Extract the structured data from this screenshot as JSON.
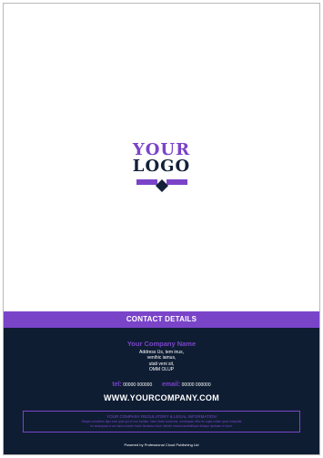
{
  "logo": {
    "line1": "YOUR",
    "line2": "LOGO",
    "mark_icon": "chevron-diamond-icon",
    "colors": {
      "accent": "#7a44c9",
      "dark": "#13203a"
    }
  },
  "contact": {
    "heading": "CONTACT DETAILS",
    "company_name": "Your Company Name",
    "address_lines": [
      "Address Us, tem inus,",
      "venihic iamus,",
      "utati veni sit,",
      "OMM OLUP"
    ],
    "tel_label": "tel:",
    "tel_value": "00000 000000",
    "email_label": "email:",
    "email_value": "00000 000000",
    "website": "WWW.YOURCOMPANY.COM"
  },
  "legal": {
    "title": "YOUR COMPANY REGULATORY & LEGAL INFORMATION",
    "line1": "Sequis voloribem dipo sum quid qui re non incitam. Nam hicae cus&ctus, consequas nihic te cupta nuliae quos molupitat",
    "line2": "tur arumquae ut am faces maxim fratur faciamus inum nihictis reiciam andebitique dituque ipictsam re inum."
  },
  "footer": {
    "powered_by": "Powered by Professional Cloud Publishing Ltd"
  },
  "colors": {
    "purple": "#7a44c9",
    "navy": "#0f1d33"
  }
}
